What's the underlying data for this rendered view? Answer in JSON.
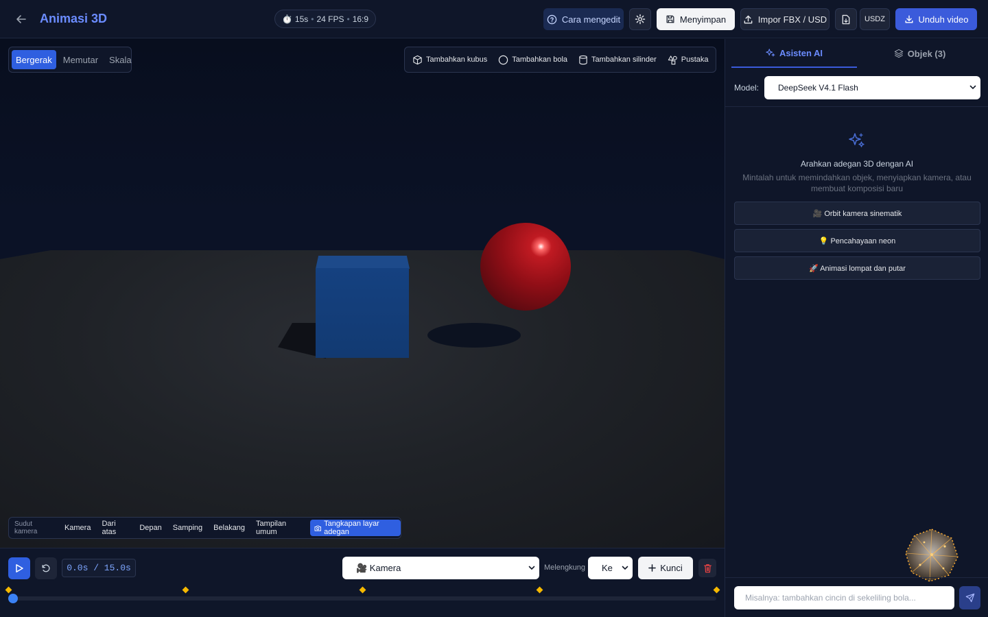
{
  "header": {
    "title": "Animasi 3D",
    "meta": {
      "duration": "15s",
      "fps": "24 FPS",
      "aspect": "16:9",
      "separator": "•"
    },
    "help_label": "Cara mengedit",
    "save_label": "Menyimpan",
    "import_label": "Impor FBX / USD",
    "usdz_label": "USDZ",
    "download_label": "Unduh video",
    "icons": {
      "back": "arrow-left-icon",
      "clock": "stopwatch-icon",
      "help": "help-circle-icon",
      "settings": "gear-icon",
      "save": "save-icon",
      "import": "upload-icon",
      "file": "file-export-icon",
      "download": "download-icon"
    }
  },
  "viewport": {
    "modes": [
      "Bergerak",
      "Memutar",
      "Skala"
    ],
    "active_mode": "Bergerak",
    "add_buttons": {
      "cube": "Tambahkan kubus",
      "sphere": "Tambahkan bola",
      "cylinder": "Tambahkan silinder",
      "library": "Pustaka"
    },
    "camera_bar": {
      "label": "Sudut kamera",
      "views": [
        "Kamera",
        "Dari atas",
        "Depan",
        "Samping",
        "Belakang",
        "Tampilan umum"
      ],
      "capture_label": "Tangkapan layar adegan"
    },
    "colors": {
      "cube": "#154180",
      "sphere": "#8f0e16",
      "floor": "#1f2227",
      "accent": "#2f5fe0"
    }
  },
  "timeline": {
    "time_display": "0.0s / 15.0s",
    "current_time": 0.0,
    "duration": 15.0,
    "keyframe_times": [
      0,
      3.75,
      7.5,
      11.25,
      15
    ],
    "track_label": "🎥 Kamera",
    "easing_label": "Melengkung",
    "easing_value": "Ke",
    "key_label": "Kunci",
    "keyframe_color": "#f5b800"
  },
  "panel": {
    "tabs": {
      "ai": "Asisten AI",
      "objects": "Objek (3)"
    },
    "active_tab": "Asisten AI",
    "model_label": "Model:",
    "model_value": "DeepSeek V4.1 Flash",
    "empty_title": "Arahkan adegan 3D dengan AI",
    "empty_subtitle": "Mintalah untuk memindahkan objek, menyiapkan kamera, atau membuat komposisi baru",
    "suggestions": [
      "🎥 Orbit kamera sinematik",
      "💡 Pencahayaan neon",
      "🚀 Animasi lompat dan putar"
    ],
    "chat_placeholder": "Misalnya: tambahkan cincin di sekeliling bola..."
  }
}
